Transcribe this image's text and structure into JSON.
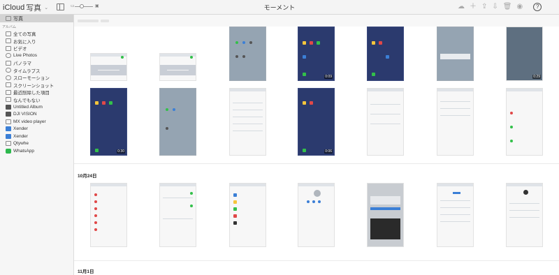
{
  "toolbar": {
    "brand": "iCloud",
    "app": "写真",
    "title": "モーメント",
    "icons": [
      "upload-cloud-icon",
      "add-icon",
      "share-icon",
      "download-icon",
      "trash-icon",
      "account-icon",
      "help-icon"
    ],
    "help_label": "?"
  },
  "sidebar": {
    "top_item": "写真",
    "section": "アルバム",
    "items": [
      {
        "label": "全ての写真",
        "icon": "album-icon"
      },
      {
        "label": "お気に入り",
        "icon": "heart-icon"
      },
      {
        "label": "ビデオ",
        "icon": "video-icon"
      },
      {
        "label": "Live Photos",
        "icon": "live-photos-icon"
      },
      {
        "label": "パノラマ",
        "icon": "panorama-icon"
      },
      {
        "label": "タイムラプス",
        "icon": "timelapse-icon"
      },
      {
        "label": "スローモーション",
        "icon": "slowmo-icon"
      },
      {
        "label": "スクリーンショット",
        "icon": "screenshot-icon"
      },
      {
        "label": "最近削除した項目",
        "icon": "trash-icon"
      },
      {
        "label": "なんでもない",
        "icon": "album-icon"
      },
      {
        "label": "Untitled Album",
        "icon": "album-icon"
      },
      {
        "label": "DJI VISION",
        "icon": "album-icon"
      },
      {
        "label": "MX video player",
        "icon": "album-icon"
      },
      {
        "label": "Xender",
        "icon": "album-icon"
      },
      {
        "label": "Xender",
        "icon": "album-icon"
      },
      {
        "label": "Qtywhe",
        "icon": "album-icon"
      },
      {
        "label": "WhatsApp",
        "icon": "album-icon"
      }
    ]
  },
  "main": {
    "sections": [
      {
        "label": "10月24日"
      },
      {
        "label": "11月1日"
      }
    ],
    "badges": {
      "r1c5": "0:09",
      "r1c7": "0:29",
      "r2c1": "0:30",
      "r2c4": "0:06"
    }
  },
  "colors": {
    "accent": "#3b7fd6",
    "selected_bg": "#d3d3d3",
    "sidebar_bg": "#f6f6f6"
  }
}
